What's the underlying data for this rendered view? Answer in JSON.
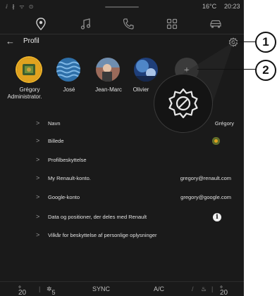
{
  "status_bar": {
    "signal": "ⅈ ∦ ᯤ ⊙",
    "temperature": "16°C",
    "time": "20:23"
  },
  "nav": {
    "items": [
      {
        "icon": "location-pin-icon"
      },
      {
        "icon": "music-note-icon"
      },
      {
        "icon": "phone-icon"
      },
      {
        "icon": "apps-grid-icon"
      },
      {
        "icon": "car-icon"
      }
    ]
  },
  "header": {
    "title": "Profil"
  },
  "profiles": [
    {
      "name": "Grégory",
      "subtitle": "Administrator."
    },
    {
      "name": "José",
      "subtitle": ""
    },
    {
      "name": "Jean-Marc",
      "subtitle": ""
    },
    {
      "name": "Olivier",
      "subtitle": ""
    }
  ],
  "add_profile": "+",
  "settings": [
    {
      "label": "Navn",
      "value": "Grégory"
    },
    {
      "label": "Billede",
      "value": ""
    },
    {
      "label": "Profilbeskyttelse",
      "value": ""
    },
    {
      "label": "My Renault-konto.",
      "value": "gregory@renault.com"
    },
    {
      "label": "Google-konto",
      "value": "gregory@google.com"
    },
    {
      "label": "Data og positioner, der deles med Renault",
      "value": ""
    },
    {
      "label": "Vilkår for beskyttelse af personlige oplysninger",
      "value": ""
    }
  ],
  "bottom_bar": {
    "temp_left": "20",
    "fan_speed": "5",
    "sync": "SYNC",
    "ac": "A/C",
    "temp_right": "20"
  },
  "callouts": [
    "1",
    "2"
  ],
  "colors": {
    "background": "#1a1a1a",
    "text": "#e6e6e6",
    "accent_yellow": "#f0b429"
  }
}
